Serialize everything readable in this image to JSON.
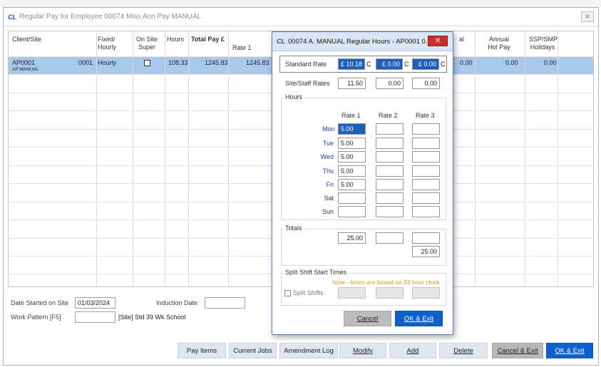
{
  "main_window": {
    "title": "Regular Pay for Employee 00074 Miss Ann Pay MANUAL",
    "logo": "CL",
    "close_label": "✕"
  },
  "grid": {
    "headers": {
      "client_site": "Client/Site",
      "fixed_hourly": "Fixed/ Hourly",
      "on_site_super": "On Site Super",
      "hours": "Hours",
      "total_pay": "Total Pay £",
      "rate1": "Rate 1",
      "annual_partial": "al",
      "annual_hol_pay": "Annual Hol Pay",
      "ssp_smp": "SSP/SMP Holidays"
    },
    "row": {
      "site_code": "AP0001",
      "site_name": "AP MANUAL",
      "num": "0001",
      "fixed_hourly": "Hourly",
      "hours": "108.33",
      "total_pay": "1245.83",
      "rate1": "1245.83",
      "col_a": "0.00",
      "col_b": "0.00",
      "col_c": "0.00"
    }
  },
  "footer_fields": {
    "date_started_label": "Date Started on Site",
    "date_started_value": "01/03/2024",
    "induction_label": "Induction Date",
    "induction_value": "",
    "work_pattern_label": "Work Pattern [F5]",
    "work_pattern_value": "",
    "work_pattern_desc": "[Site] Std 39 Wk School"
  },
  "buttons": {
    "pay_items": "Pay Items",
    "current_jobs": "Current Jobs",
    "amendment_log": "Amendment Log",
    "modify": "Modify",
    "add": "Add",
    "delete": "Delete",
    "cancel_exit": "Cancel & Exit",
    "ok_exit": "OK & Exit"
  },
  "dialog": {
    "logo": "CL",
    "title": "00074 A. MANUAL  Regular Hours - AP0001 0...",
    "close_label": "✕",
    "standard_rate_label": "Standard Rate",
    "standard_rates": [
      "£ 10.18",
      "£ 0.00",
      "£ 0.00"
    ],
    "rate_suffix": "C",
    "site_staff_label": "Site/Staff Rates",
    "site_staff_rates": [
      "11.50",
      "0.00",
      "0.00"
    ],
    "hours_label": "Hours",
    "rate_headers": [
      "Rate 1",
      "Rate 2",
      "Rate 3"
    ],
    "days": [
      {
        "name": "Mon",
        "r1": "5.00",
        "r2": "",
        "r3": ""
      },
      {
        "name": "Tue",
        "r1": "5.00",
        "r2": "",
        "r3": ""
      },
      {
        "name": "Wed",
        "r1": "5.00",
        "r2": "",
        "r3": ""
      },
      {
        "name": "Thu",
        "r1": "5.00",
        "r2": "",
        "r3": ""
      },
      {
        "name": "Fri",
        "r1": "5.00",
        "r2": "",
        "r3": ""
      },
      {
        "name": "Sat",
        "r1": "",
        "r2": "",
        "r3": ""
      },
      {
        "name": "Sun",
        "r1": "",
        "r2": "",
        "r3": ""
      }
    ],
    "totals_label": "Totals",
    "totals": [
      "25.00",
      "",
      ""
    ],
    "grand_total": "25.00",
    "split_shift_label": "Split Shift Start Times",
    "split_note": "Note - times are based on 24 hour clock",
    "split_shifts_checkbox": "Split Shifts",
    "cancel": "Cancel",
    "ok_exit": "OK & Exit"
  }
}
